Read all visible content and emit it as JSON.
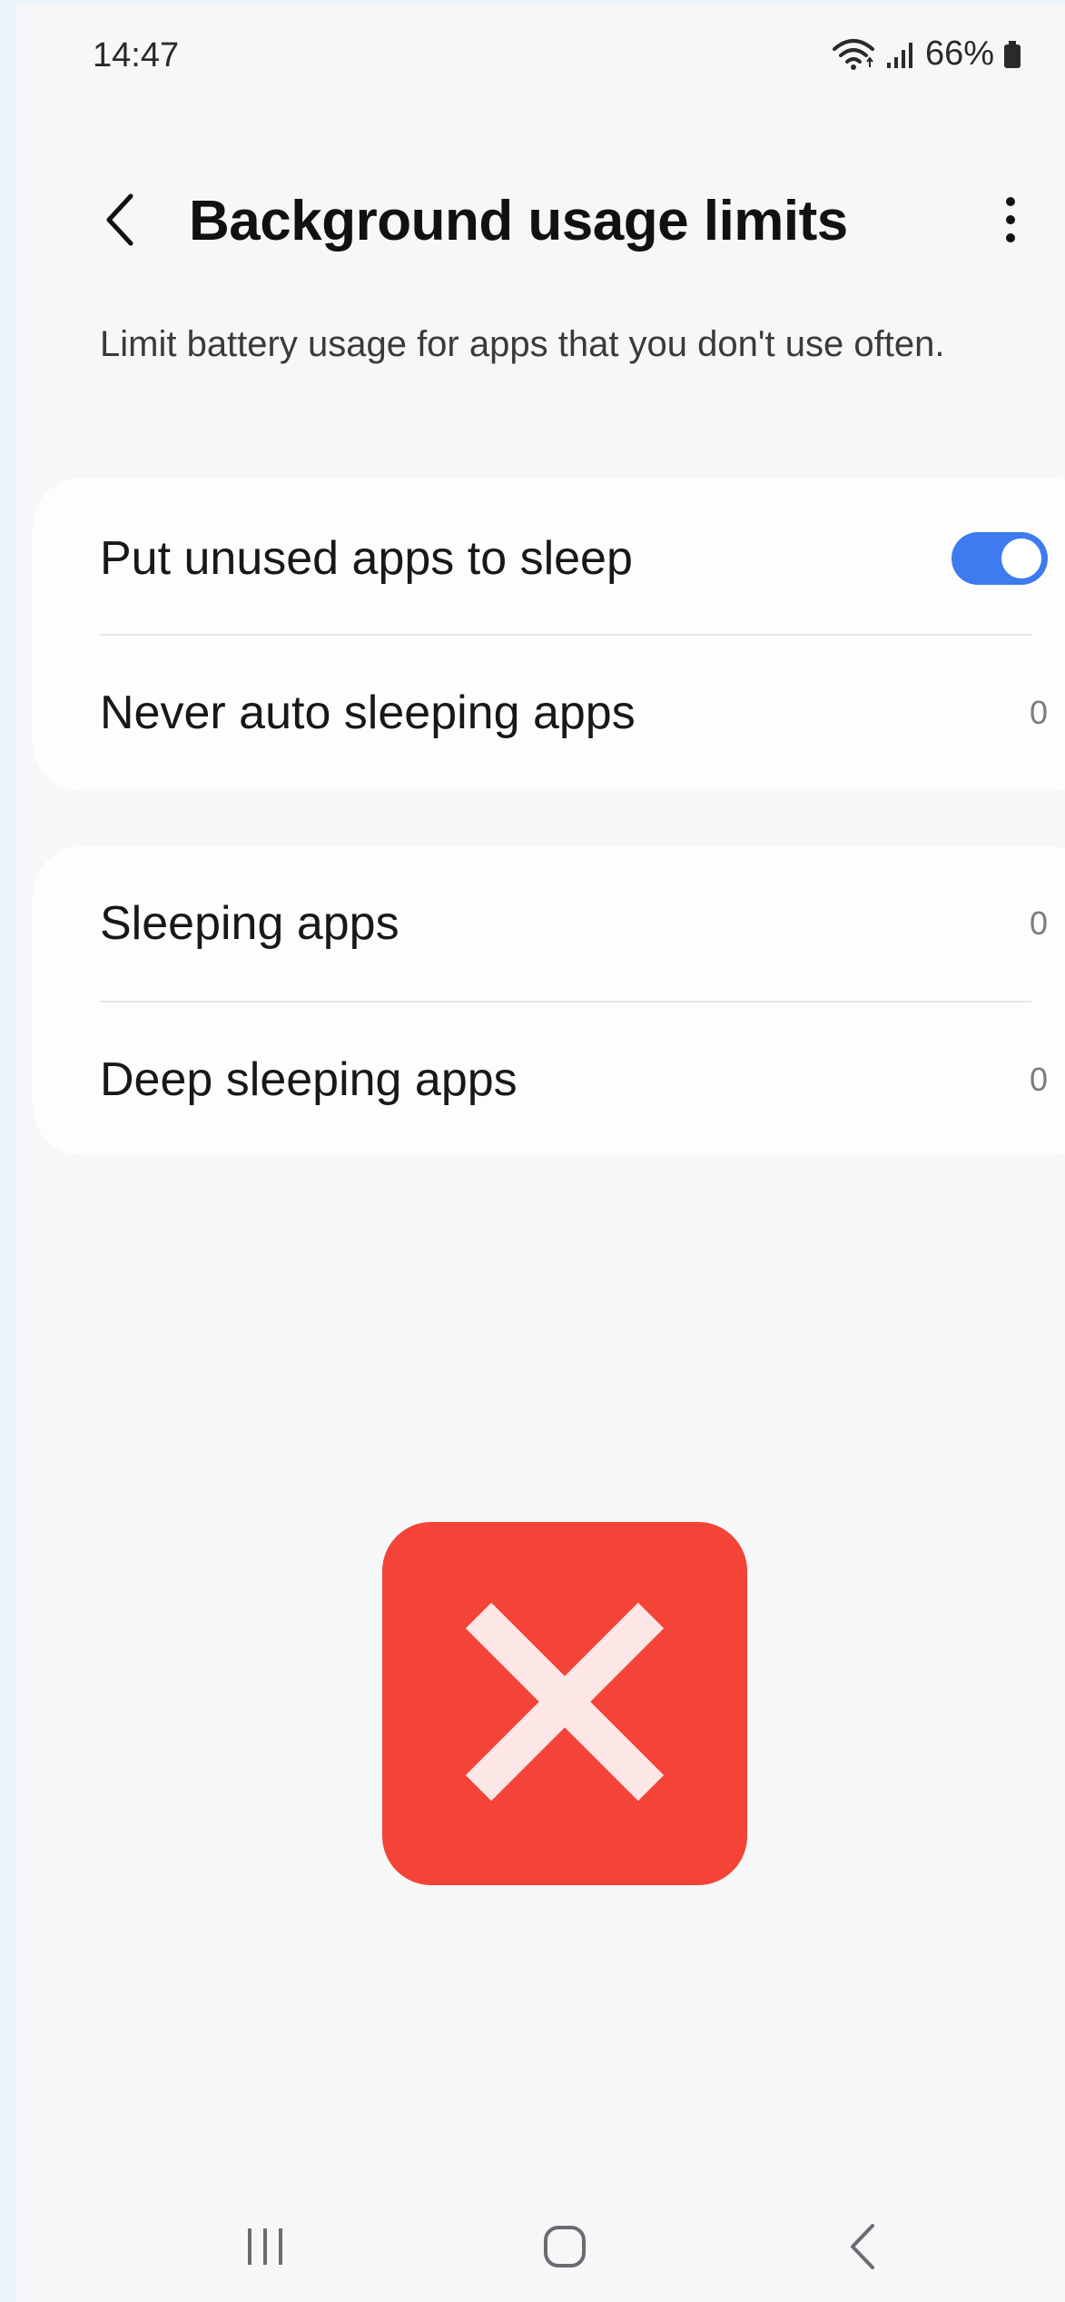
{
  "status_bar": {
    "time": "14:47",
    "battery": "66%",
    "icons": [
      "wifi-icon",
      "signal-icon",
      "battery-icon"
    ]
  },
  "header": {
    "title": "Background usage limits",
    "back_icon": "chevron-left-icon",
    "more_icon": "more-vertical-icon"
  },
  "description": "Limit battery usage for apps that you don't use often.",
  "sections": [
    {
      "items": [
        {
          "label": "Put unused apps to sleep",
          "toggle_on": true
        },
        {
          "label": "Never auto sleeping apps",
          "count": "0"
        }
      ]
    },
    {
      "items": [
        {
          "label": "Sleeping apps",
          "count": "0"
        },
        {
          "label": "Deep sleeping apps",
          "count": "0"
        }
      ]
    }
  ],
  "overlay": {
    "icon": "close-x-icon",
    "color": "#f34437"
  },
  "nav_bar": {
    "icons": [
      "recents-icon",
      "home-icon",
      "back-icon"
    ]
  },
  "colors": {
    "accent": "#3e7bef",
    "background": "#f6f7f9",
    "card": "#fdfdfe"
  }
}
